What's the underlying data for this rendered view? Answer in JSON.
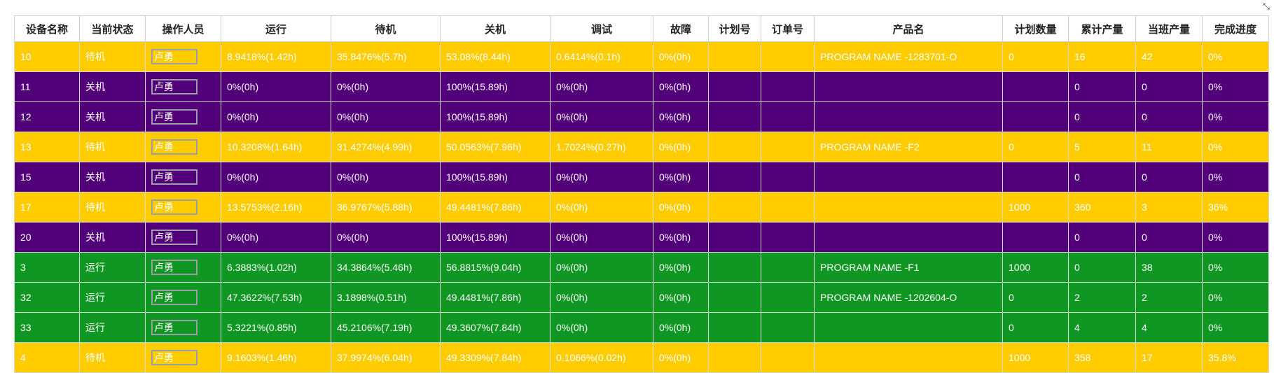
{
  "columns": [
    "设备名称",
    "当前状态",
    "操作人员",
    "运行",
    "待机",
    "关机",
    "调试",
    "故障",
    "计划号",
    "订单号",
    "产品名",
    "计划数量",
    "累计产量",
    "当班产量",
    "完成进度"
  ],
  "status_colors": {
    "待机": "#ffcc00",
    "关机": "#52007a",
    "运行": "#109622"
  },
  "rows": [
    {
      "device": "10",
      "status": "待机",
      "operator": "卢勇",
      "run": "8.9418%(1.42h)",
      "standby": "35.8476%(5.7h)",
      "off": "53.08%(8.44h)",
      "debug": "0.6414%(0.1h)",
      "fault": "0%(0h)",
      "plan_no": "",
      "order_no": "",
      "product": "PROGRAM NAME -1283701-O",
      "plan_qty": "0",
      "total_output": "16",
      "shift_output": "42",
      "progress": "0%"
    },
    {
      "device": "11",
      "status": "关机",
      "operator": "卢勇",
      "run": "0%(0h)",
      "standby": "0%(0h)",
      "off": "100%(15.89h)",
      "debug": "0%(0h)",
      "fault": "0%(0h)",
      "plan_no": "",
      "order_no": "",
      "product": "",
      "plan_qty": "",
      "total_output": "0",
      "shift_output": "0",
      "progress": "0%"
    },
    {
      "device": "12",
      "status": "关机",
      "operator": "卢勇",
      "run": "0%(0h)",
      "standby": "0%(0h)",
      "off": "100%(15.89h)",
      "debug": "0%(0h)",
      "fault": "0%(0h)",
      "plan_no": "",
      "order_no": "",
      "product": "",
      "plan_qty": "",
      "total_output": "0",
      "shift_output": "0",
      "progress": "0%"
    },
    {
      "device": "13",
      "status": "待机",
      "operator": "卢勇",
      "run": "10.3208%(1.64h)",
      "standby": "31.4274%(4.99h)",
      "off": "50.0563%(7.96h)",
      "debug": "1.7024%(0.27h)",
      "fault": "0%(0h)",
      "plan_no": "",
      "order_no": "",
      "product": "PROGRAM NAME -F2",
      "plan_qty": "0",
      "total_output": "5",
      "shift_output": "11",
      "progress": "0%"
    },
    {
      "device": "15",
      "status": "关机",
      "operator": "卢勇",
      "run": "0%(0h)",
      "standby": "0%(0h)",
      "off": "100%(15.89h)",
      "debug": "0%(0h)",
      "fault": "0%(0h)",
      "plan_no": "",
      "order_no": "",
      "product": "",
      "plan_qty": "",
      "total_output": "0",
      "shift_output": "0",
      "progress": "0%"
    },
    {
      "device": "17",
      "status": "待机",
      "operator": "卢勇",
      "run": "13.5753%(2.16h)",
      "standby": "36.9767%(5.88h)",
      "off": "49.4481%(7.86h)",
      "debug": "0%(0h)",
      "fault": "0%(0h)",
      "plan_no": "",
      "order_no": "",
      "product": "",
      "plan_qty": "1000",
      "total_output": "360",
      "shift_output": "3",
      "progress": "36%"
    },
    {
      "device": "20",
      "status": "关机",
      "operator": "卢勇",
      "run": "0%(0h)",
      "standby": "0%(0h)",
      "off": "100%(15.89h)",
      "debug": "0%(0h)",
      "fault": "0%(0h)",
      "plan_no": "",
      "order_no": "",
      "product": "",
      "plan_qty": "",
      "total_output": "0",
      "shift_output": "0",
      "progress": "0%"
    },
    {
      "device": "3",
      "status": "运行",
      "operator": "卢勇",
      "run": "6.3883%(1.02h)",
      "standby": "34.3864%(5.46h)",
      "off": "56.8815%(9.04h)",
      "debug": "0%(0h)",
      "fault": "0%(0h)",
      "plan_no": "",
      "order_no": "",
      "product": "PROGRAM NAME -F1",
      "plan_qty": "1000",
      "total_output": "0",
      "shift_output": "38",
      "progress": "0%"
    },
    {
      "device": "32",
      "status": "运行",
      "operator": "卢勇",
      "run": "47.3622%(7.53h)",
      "standby": "3.1898%(0.51h)",
      "off": "49.4481%(7.86h)",
      "debug": "0%(0h)",
      "fault": "0%(0h)",
      "plan_no": "",
      "order_no": "",
      "product": "PROGRAM NAME -1202604-O",
      "plan_qty": "0",
      "total_output": "2",
      "shift_output": "2",
      "progress": "0%"
    },
    {
      "device": "33",
      "status": "运行",
      "operator": "卢勇",
      "run": "5.3221%(0.85h)",
      "standby": "45.2106%(7.19h)",
      "off": "49.3607%(7.84h)",
      "debug": "0%(0h)",
      "fault": "0%(0h)",
      "plan_no": "",
      "order_no": "",
      "product": "",
      "plan_qty": "0",
      "total_output": "4",
      "shift_output": "4",
      "progress": "0%"
    },
    {
      "device": "4",
      "status": "待机",
      "operator": "卢勇",
      "run": "9.1603%(1.46h)",
      "standby": "37.9974%(6.04h)",
      "off": "49.3309%(7.84h)",
      "debug": "0.1066%(0.02h)",
      "fault": "0%(0h)",
      "plan_no": "",
      "order_no": "",
      "product": "",
      "plan_qty": "1000",
      "total_output": "358",
      "shift_output": "17",
      "progress": "35.8%"
    }
  ]
}
